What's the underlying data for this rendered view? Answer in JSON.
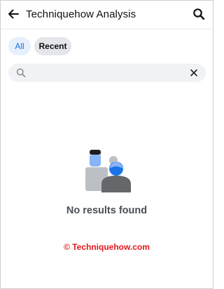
{
  "header": {
    "title": "Techniquehow Analysis",
    "back_icon": "arrow-left-icon",
    "search_icon": "search-icon"
  },
  "filters": {
    "all_label": "All",
    "recent_label": "Recent"
  },
  "search": {
    "value": "",
    "search_icon": "search-icon",
    "clear_icon": "close-icon"
  },
  "empty_state": {
    "illustration": "people-icon",
    "message": "No results found"
  },
  "watermark": {
    "text": "© Techniquehow.com"
  },
  "colors": {
    "accent": "#1a73e8",
    "chip_active_bg": "#e6f0fc",
    "chip_bg": "#e4e6eb",
    "search_bg": "#f0f2f5",
    "watermark": "#e0161b"
  }
}
